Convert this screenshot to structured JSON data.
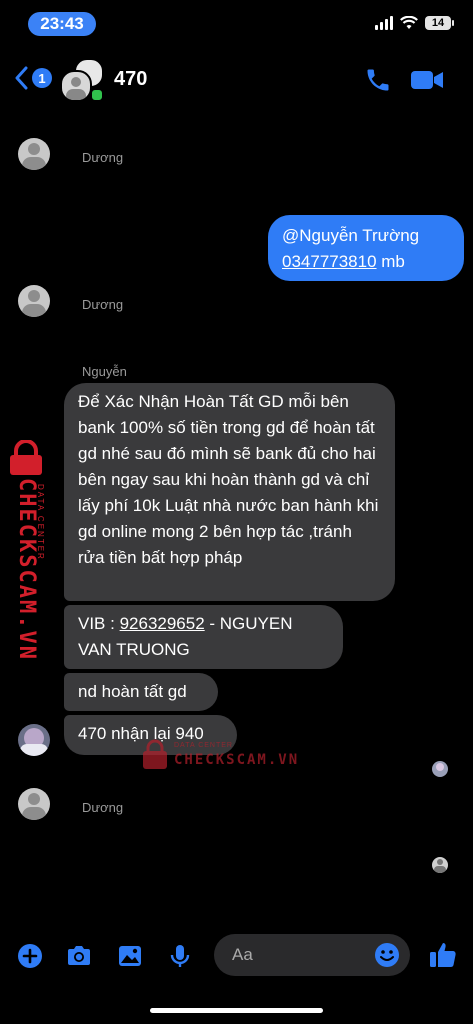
{
  "status_bar": {
    "time": "23:43",
    "battery": "14"
  },
  "header": {
    "back_badge": "1",
    "title": "470"
  },
  "participants": {
    "duong": "Dương",
    "nguyen": "Nguyễn"
  },
  "messages": {
    "outgoing_1": {
      "line1": "@Nguyễn Trường",
      "phone": "0347773810",
      "suffix": " mb"
    },
    "incoming_1": "Để Xác Nhận Hoàn Tất GD mỗi bên bank 100% số tiền trong gd để hoàn tất gd nhé sau đó mình sẽ bank đủ cho hai bên ngay sau khi hoàn thành gd và chỉ lấy phí 10k Luật nhà nước ban hành khi gd online mong 2 bên hợp tác ,tránh rửa tiền bất hợp pháp",
    "incoming_2": {
      "prefix": "VIB : ",
      "account": "926329652",
      "suffix": " - NGUYEN VAN TRUONG"
    },
    "incoming_3": "nd hoàn tất gd",
    "incoming_4": "470 nhận lại 940"
  },
  "watermark": {
    "brand": "CHECKSCAM.VN",
    "sub": "DATA CENTER"
  },
  "composer": {
    "placeholder": "Aa"
  },
  "colors": {
    "accent": "#2f7cf6",
    "bubble_in": "#3a3a3c",
    "watermark": "#d21f2b"
  }
}
